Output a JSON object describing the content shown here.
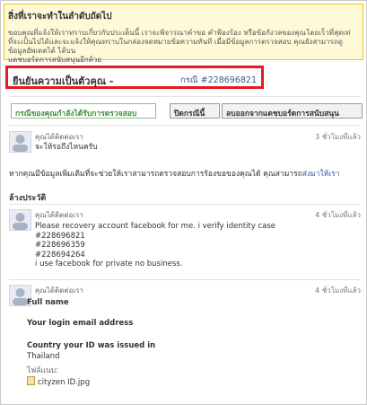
{
  "notice": {
    "title": "สิ่งที่เราจะทำในลำดับถัดไป",
    "line1": "ขอบคุณที่แจ้งให้เราทราบเกี่ยวกับประเด็นนี้ เราจะพิจารณาคำขอ คำฟ้องร้อง หรือข้อกังวลของคุณโดยเร็วที่สุดเท่",
    "line2": "ที่จะเป็นไปได้และจะแจ้งให้คุณทราบในกล่องจดหมายข้อความทันที เมื่อมีข้อมูลการตรวจสอบ คุณยังสามารถดูข้อมูลอัพเดตได้ ได้บน",
    "line3": "แดชบอร์ดการสนับสนุนอีกด้วย"
  },
  "case": {
    "title": "ยืนยันความเป็นตัวคุณ -",
    "number": "กรณี #228696821"
  },
  "toolbar": {
    "status": "กรณีของคุณกำลังได้รับการตรวจสอบ",
    "close": "ปิดกรณีนี้",
    "delete": "ลบออกจากแดชบอร์ดการสนับสนุน"
  },
  "post1": {
    "name": "คุณได้ติดต่อเรา",
    "time": "3 ชั่วโมงที่แล้ว",
    "text": "จะให้รอถึงไหนครับ"
  },
  "info": {
    "text": "หากคุณมีข้อมูลเพิ่มเติมที่จะช่วยให้เราสามารถตรวจสอบการร้องขอของคุณได้ คุณสามารถ",
    "link": "ส่งมาให้เรา"
  },
  "history": {
    "title": "ล้างประวัติ"
  },
  "post2": {
    "name": "คุณได้ติดต่อเรา",
    "time": "4 ชั่วโมงที่แล้ว",
    "lines": [
      "Please recovery account facebook for me. i verify identity case",
      "#228696821",
      "#228696359",
      "#228694264",
      "i use facebook for private no business."
    ]
  },
  "post3": {
    "name": "คุณได้ติดต่อเรา",
    "time": "4 ชั่วโมงที่แล้ว",
    "field1_label": "Full name",
    "field2_label": "Your login email address",
    "field3_label": "Country your ID was issued in",
    "field3_value": "Thailand",
    "attach_label": "ไฟล์แนบ:",
    "attach_file": "cityzen ID.jpg"
  }
}
